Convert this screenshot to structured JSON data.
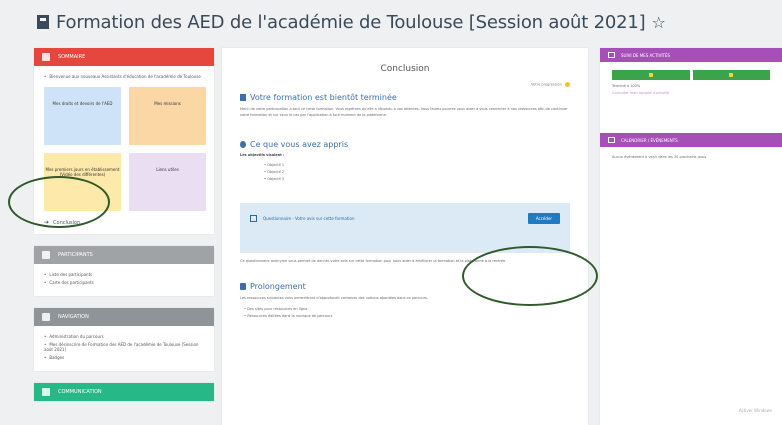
{
  "page": {
    "title": "Formation des AED de l'académie de Toulouse [Session août 2021]"
  },
  "left": {
    "summary_block": {
      "header": "Sommaire",
      "intro": "Bienvenue aux nouveaux Assistants d'éducation de l'académie de Toulouse",
      "tiles": [
        {
          "label": "Mes droits et devoirs de l'AED"
        },
        {
          "label": "Mes missions"
        },
        {
          "label": "Mes premiers jours en établissement (Vidéo des différentes)"
        },
        {
          "label": "Liens utiles"
        }
      ],
      "conclusion_link": "Conclusion"
    },
    "participants_block": {
      "header": "Participants",
      "items": [
        "Liste des participants",
        "Carte des participants"
      ]
    },
    "navigation_block": {
      "header": "Navigation",
      "items": [
        "Administration du parcours",
        "Mes désinscrire de Formation des AED de l'académie de Toulouse [Session août 2021]",
        "Badges"
      ]
    },
    "communication_block": {
      "header": "Communication"
    }
  },
  "main": {
    "section_title": "Conclusion",
    "progress_label": "Votre progression",
    "heading1": "Votre formation est bientôt terminée",
    "para1": "Merci de votre participation à tout ce cette formation. Vous espérons qu'elle a répondu à vos attentes. Vous faurez pourrez vous aider à vous connecter à nos ressources afin de continuer votre formation et sur ceux le cas par l'application à tout moment de la plateforme.",
    "heading2": "Ce que vous avez appris",
    "objectives_label": "Les objectifs visaient :",
    "objectives": [
      "Objectif 1",
      "Objectif 2",
      "Objectif 3"
    ],
    "survey_text": "Questionnaire - Votre avis sur cette formation",
    "survey_button": "Accéder",
    "survey_note": "Ce questionnaire anonyme vous permet de donner votre avis sur cette formation pour nous aider à améliorer la formation et la plateforme à la rentrée.",
    "heading3": "Prolongement",
    "para3": "Les ressources suivantes vous permettront d'approfondir certaines des notions abordées dans ce parcours.",
    "final_items": [
      "Des sites pour ressources en ligne",
      "Ressources éditées dans la rubrique de parcours"
    ]
  },
  "right": {
    "activity_block": {
      "header": "Suivi de mes activités",
      "completion_label": "Terminé à 100%",
      "link": "Consulter mon rapport d'activité"
    },
    "calendar_block": {
      "header": "Calendrier / Événements",
      "text": "Aucun événement à venir dans les 30 prochains jours"
    },
    "watermark": "Activer Windows"
  },
  "colors": {
    "summary_header": "#e5463d",
    "participants_header": "#9fa3a5",
    "navigation_header": "#8e9498",
    "communication_header": "#26b887",
    "right_header": "#a74fb8",
    "annotation": "#2f5a2a"
  }
}
